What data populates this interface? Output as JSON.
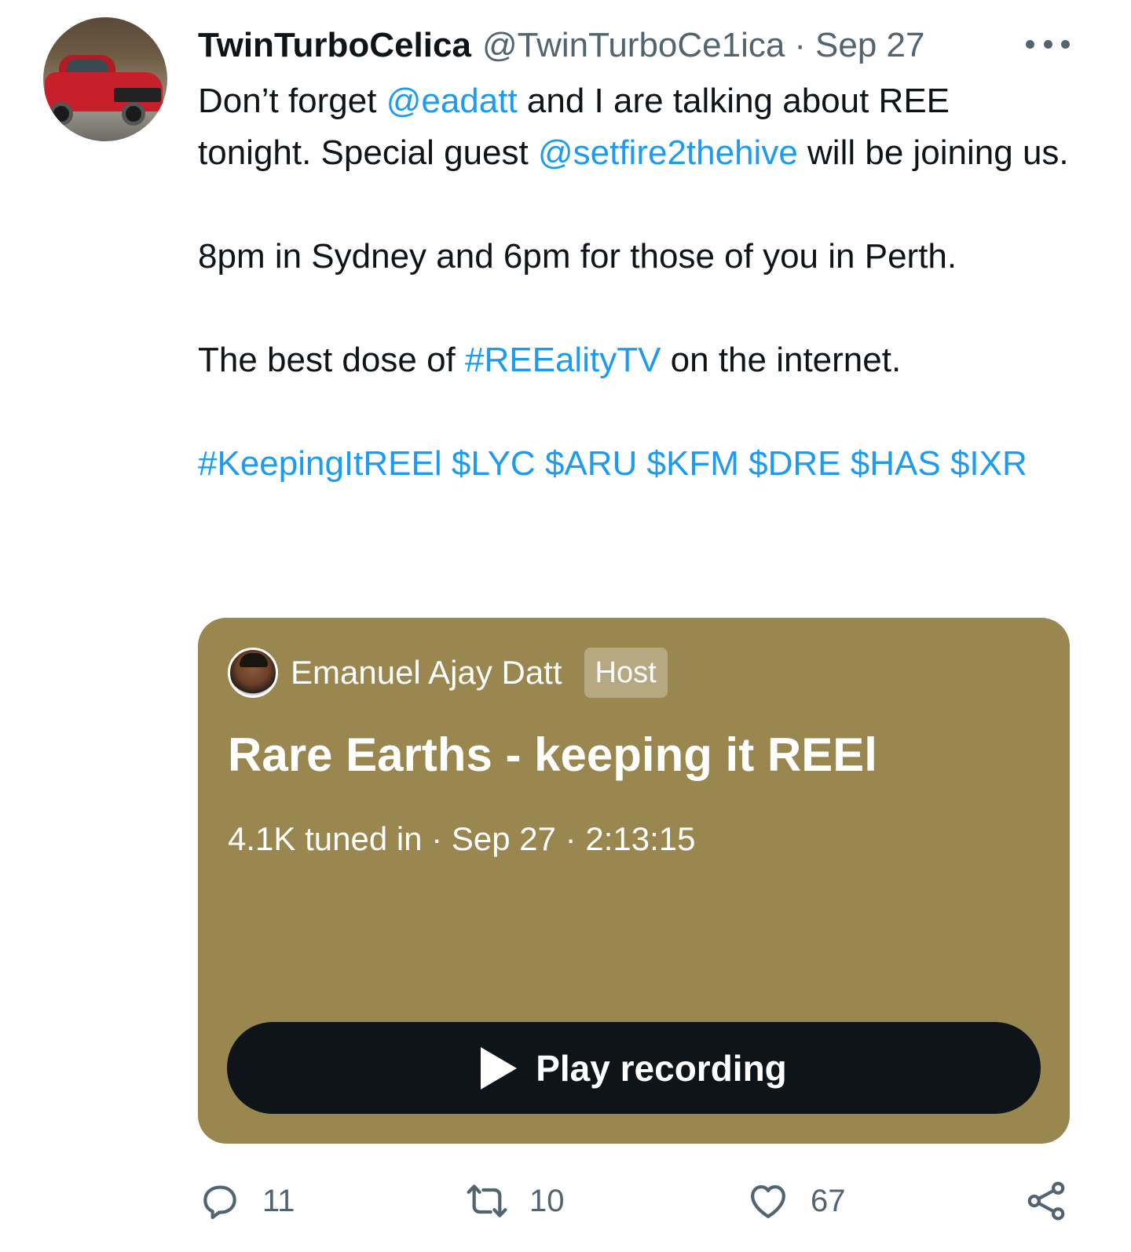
{
  "tweet": {
    "author": {
      "display_name": "TwinTurboCelica",
      "handle": "@TwinTurboCe1ica",
      "separator": "·",
      "date": "Sep 27"
    },
    "text": {
      "p1_a": "Don’t forget ",
      "p1_mention1": "@eadatt",
      "p1_b": " and I are talking about REE tonight. Special guest ",
      "p1_mention2": "@setfire2thehive",
      "p1_c": " will be joining us.",
      "p2": "8pm in Sydney and 6pm for those of you in Perth.",
      "p3_a": "The best dose of ",
      "p3_hashtag": "#REEalityTV",
      "p3_b": " on the internet.",
      "tags": [
        "#KeepingItREEl",
        "$LYC",
        "$ARU",
        "$KFM",
        "$DRE",
        "$HAS",
        "$IXR"
      ]
    },
    "space": {
      "host_name": "Emanuel Ajay Datt",
      "host_badge": "Host",
      "title": "Rare Earths - keeping it REEl",
      "tuned_in": "4.1K tuned in",
      "date": "Sep 27",
      "duration": "2:13:15",
      "meta_separator": "·",
      "play_label": "Play recording",
      "card_color": "#9a864f"
    },
    "actions": {
      "replies": "11",
      "retweets": "10",
      "likes": "67"
    }
  },
  "colors": {
    "link": "#1d9bf0",
    "secondary_text": "#536471",
    "primary_text": "#0f1419"
  },
  "icons": [
    "more-icon",
    "reply-icon",
    "retweet-icon",
    "like-icon",
    "share-icon",
    "play-icon"
  ]
}
